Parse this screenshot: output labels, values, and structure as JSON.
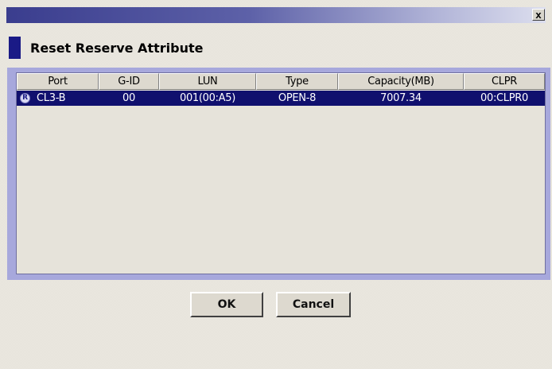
{
  "window": {
    "close_label": "x"
  },
  "heading": "Reset Reserve Attribute",
  "table": {
    "columns": [
      "Port",
      "G-ID",
      "LUN",
      "Type",
      "Capacity(MB)",
      "CLPR"
    ],
    "rows": [
      {
        "icon": "R",
        "port": "CL3-B",
        "gid": "00",
        "lun": "001(00:A5)",
        "type": "OPEN-8",
        "capacity": "7007.34",
        "clpr": "00:CLPR0"
      }
    ]
  },
  "buttons": {
    "ok": "OK",
    "cancel": "Cancel"
  },
  "colors": {
    "title_start": "#3a3d8e",
    "selection": "#10106e",
    "frame": "#a7a8dc",
    "marker": "#1a1a86"
  }
}
